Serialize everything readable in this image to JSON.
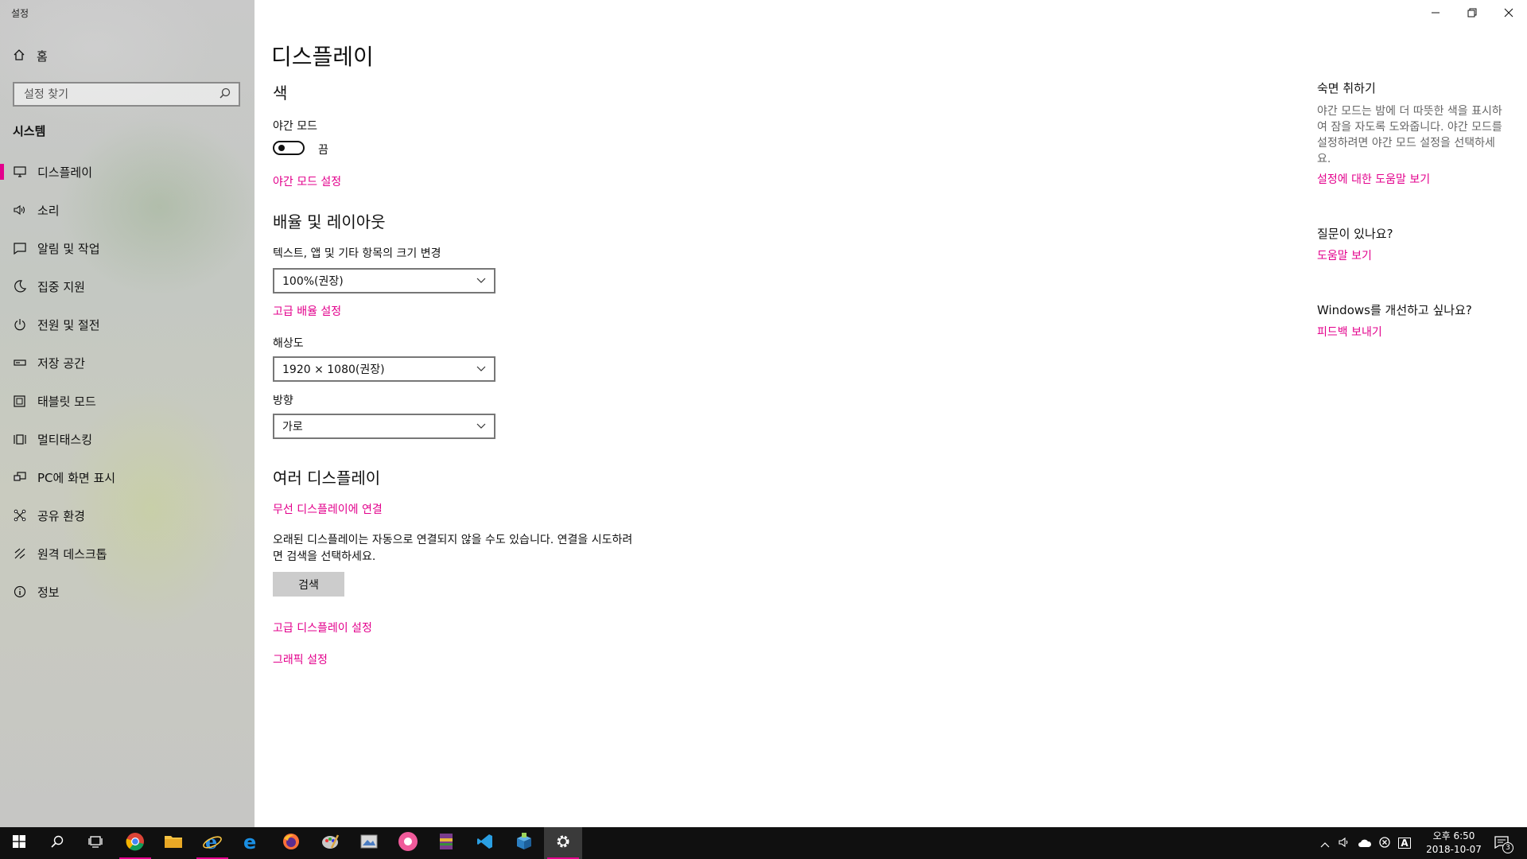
{
  "window": {
    "app_title": "설정",
    "controls": {
      "minimize": "minimize-icon",
      "restore": "restore-icon",
      "close": "close-icon"
    }
  },
  "sidebar": {
    "home_label": "홈",
    "search_placeholder": "설정 찾기",
    "section_title": "시스템",
    "items": [
      {
        "label": "디스플레이",
        "icon": "display-icon",
        "active": true
      },
      {
        "label": "소리",
        "icon": "speaker-icon"
      },
      {
        "label": "알림 및 작업",
        "icon": "notification-icon"
      },
      {
        "label": "집중 지원",
        "icon": "moon-icon"
      },
      {
        "label": "전원 및 절전",
        "icon": "power-icon"
      },
      {
        "label": "저장 공간",
        "icon": "storage-icon"
      },
      {
        "label": "태블릿 모드",
        "icon": "tablet-icon"
      },
      {
        "label": "멀티태스킹",
        "icon": "multitasking-icon"
      },
      {
        "label": "PC에 화면 표시",
        "icon": "project-icon"
      },
      {
        "label": "공유 환경",
        "icon": "share-icon"
      },
      {
        "label": "원격 데스크톱",
        "icon": "remote-desktop-icon"
      },
      {
        "label": "정보",
        "icon": "info-icon"
      }
    ]
  },
  "main": {
    "title": "디스플레이",
    "color": {
      "heading": "색",
      "night_light_label": "야간 모드",
      "night_light_state": "끔",
      "night_light_settings_link": "야간 모드 설정"
    },
    "scale_layout": {
      "heading": "배율 및 레이아웃",
      "scale_label": "텍스트, 앱 및 기타 항목의 크기 변경",
      "scale_value": "100%(권장)",
      "advanced_scaling_link": "고급 배율 설정",
      "resolution_label": "해상도",
      "resolution_value": "1920 × 1080(권장)",
      "orientation_label": "방향",
      "orientation_value": "가로"
    },
    "multiple_displays": {
      "heading": "여러 디스플레이",
      "wireless_link": "무선 디스플레이에 연결",
      "description": "오래된 디스플레이는 자동으로 연결되지 않을 수도 있습니다. 연결을 시도하려면 검색을 선택하세요.",
      "detect_button": "검색",
      "advanced_display_link": "고급 디스플레이 설정",
      "graphics_link": "그래픽 설정"
    }
  },
  "right_pane": {
    "sleep_heading": "숙면 취하기",
    "sleep_text": "야간 모드는 밤에 더 따뜻한 색을 표시하여 잠을 자도록 도와줍니다. 야간 모드를 설정하려면 야간 모드 설정을 선택하세요.",
    "sleep_link": "설정에 대한 도움말 보기",
    "question_heading": "질문이 있나요?",
    "question_link": "도움말 보기",
    "feedback_heading": "Windows를 개선하고 싶나요?",
    "feedback_link": "피드백 보내기"
  },
  "taskbar": {
    "apps": [
      "windows-start-icon",
      "search-icon",
      "task-view-icon",
      "chrome-icon",
      "file-explorer-icon",
      "internet-explorer-icon",
      "edge-icon",
      "firefox-icon",
      "paint-app-icon",
      "photos-app-icon",
      "pink-circle-app-icon",
      "winrar-icon",
      "visual-studio-icon",
      "package-app-icon",
      "settings-gear-icon"
    ],
    "clock_time": "오후 6:50",
    "clock_date": "2018-10-07",
    "ime_indicator": "A",
    "notification_count": "3",
    "accent_color": "#e3008c"
  }
}
